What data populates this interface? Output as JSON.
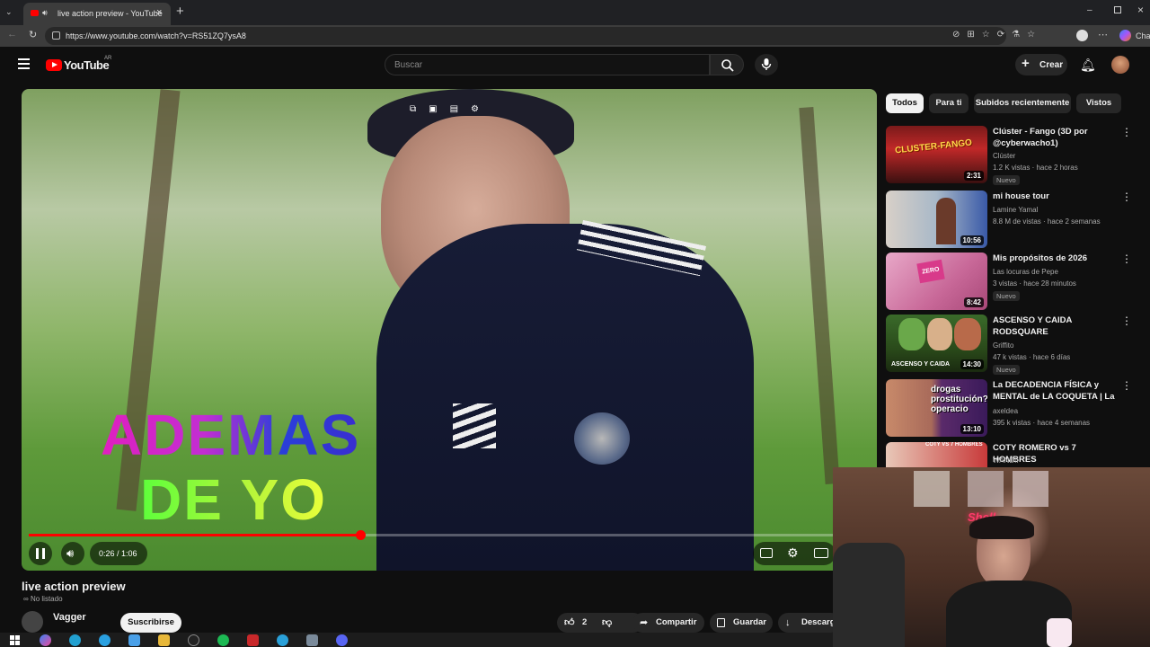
{
  "browser": {
    "tab_title": "live action preview - YouTube",
    "url": "https://www.youtube.com/watch?v=RS51ZQ7ysA8",
    "profile_label": "Cha"
  },
  "youtube": {
    "logo_text": "YouTube",
    "region_code": "AR",
    "search_placeholder": "Buscar",
    "create_label": "Crear"
  },
  "video": {
    "overlay_text_line1": "ADEMAS",
    "overlay_text_line2": "DE YO",
    "time_display": "0:26 / 1:06",
    "progress_fraction": 0.393,
    "title": "live action preview",
    "visibility": "No listado",
    "channel": "Vagger",
    "subscribe_label": "Suscribirse",
    "like_count": "2",
    "share_label": "Compartir",
    "save_label": "Guardar",
    "download_label": "Descarg"
  },
  "sidebar": {
    "chips": [
      {
        "label": "Todos",
        "active": true
      },
      {
        "label": "Para ti",
        "active": false
      },
      {
        "label": "Subidos recientemente",
        "active": false
      },
      {
        "label": "Vistos",
        "active": false
      }
    ],
    "items": [
      {
        "title": "Clúster - Fango (3D por @cyberwacho1)",
        "channel": "Clúster",
        "meta": "1.2 K vistas · hace 2 horas",
        "badge": "Nuevo",
        "duration": "2:31",
        "thumb_text": "CLUSTER-FANGO"
      },
      {
        "title": "mi house tour",
        "channel": "Lamine Yamal",
        "meta": "8.8 M de vistas · hace 2 semanas",
        "badge": "",
        "duration": "10:56",
        "thumb_text": ""
      },
      {
        "title": "Mis propósitos de 2026",
        "channel": "Las locuras de Pepe",
        "meta": "3 vistas · hace 28 minutos",
        "badge": "Nuevo",
        "duration": "8:42",
        "thumb_text": "ZERO"
      },
      {
        "title": "ASCENSO Y CAIDA RODSQUARE",
        "channel": "Griffito",
        "meta": "47 k vistas · hace 6 días",
        "badge": "Nuevo",
        "duration": "14:30",
        "thumb_text": "ASCENSO Y CAIDA"
      },
      {
        "title": "La DECADENCIA FÍSICA y MENTAL de LA COQUETA | La ...",
        "channel": "axeldea",
        "meta": "395 k vistas · hace 4 semanas",
        "badge": "",
        "duration": "13:10",
        "thumb_text": "drogas prostitución? operacio"
      },
      {
        "title": "COTY ROMERO vs 7 HOMBRES",
        "channel": "WANDII",
        "meta": "",
        "badge": "",
        "duration": "",
        "thumb_text": "COTY VS 7 HOMBRES"
      }
    ]
  },
  "webcam": {
    "sign_text": "Shell"
  },
  "colors": {
    "progress": "#ff0000",
    "yt_red": "#ff0000",
    "bg": "#0f0f0f"
  }
}
